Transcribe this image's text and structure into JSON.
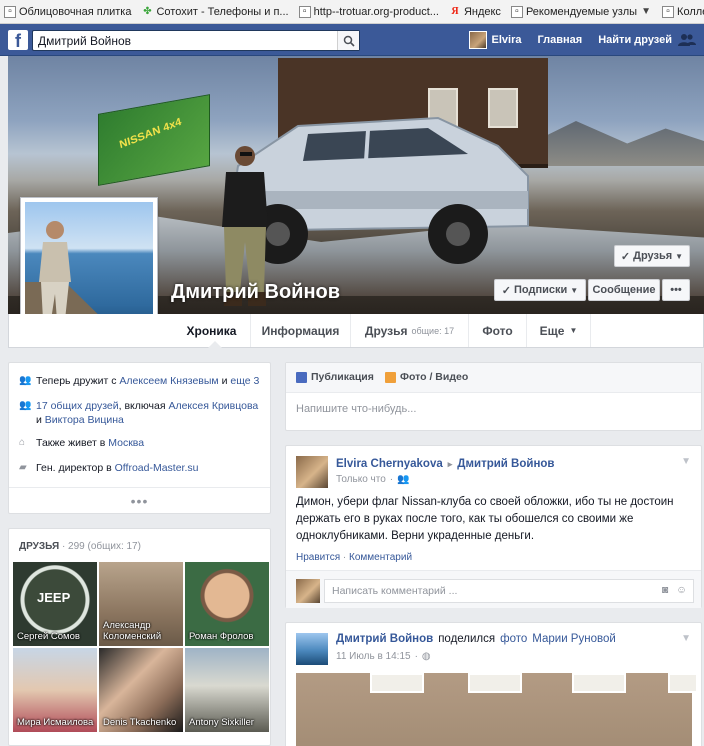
{
  "bookmarks": [
    {
      "icon": "page-icon",
      "label": "Облицовочная плитка"
    },
    {
      "icon": "leaf-icon",
      "label": "Сотохит - Телефоны и п..."
    },
    {
      "icon": "page-icon",
      "label": "http--trotuar.org-product..."
    },
    {
      "icon": "yandex-icon",
      "label": "Яндекс"
    },
    {
      "icon": "page-icon",
      "label": "Рекомендуемые узлы"
    },
    {
      "icon": "page-icon",
      "label": "Коллекция веб-фрагм..."
    }
  ],
  "topbar": {
    "logo": "f",
    "search_value": "Дмитрий Войнов",
    "user": "Elvira",
    "home": "Главная",
    "find_friends": "Найти друзей"
  },
  "profile": {
    "name": "Дмитрий Войнов",
    "flag_text": "NISSAN 4x4",
    "friends_button": "Друзья",
    "subscriptions_button": "Подписки",
    "message_button": "Сообщение",
    "more_button": "•••"
  },
  "tabs": [
    {
      "label": "Хроника",
      "sub": ""
    },
    {
      "label": "Информация",
      "sub": ""
    },
    {
      "label": "Друзья",
      "sub": "общие: 17"
    },
    {
      "label": "Фото",
      "sub": ""
    },
    {
      "label": "Еще",
      "sub": ""
    }
  ],
  "intro": {
    "row1": {
      "text": "Теперь дружит с",
      "link1": "Алексеем Князевым",
      "and": "и",
      "link2": "еще 3"
    },
    "row2": {
      "link1": "17 общих друзей",
      "text": ", включая",
      "link2": "Алексея Кривцова",
      "and": "и",
      "link3": "Виктора Вицина"
    },
    "row3": {
      "text": "Также живет в",
      "link": "Москва"
    },
    "row4": {
      "text": "Ген. директор в",
      "link": "Offroad-Master.su"
    },
    "more": "•••"
  },
  "friends_card": {
    "title": "Друзья",
    "count": "· 299 (общих: 17)",
    "items": [
      {
        "name": "Сергей Сомов"
      },
      {
        "name": "Александр Коломенский"
      },
      {
        "name": "Роман Фролов"
      },
      {
        "name": "Мира Исмаилова"
      },
      {
        "name": "Denis Tkachenko"
      },
      {
        "name": "Antony Sixkiller"
      }
    ],
    "jeep_text": "JEEP"
  },
  "composer": {
    "tab1": "Публикация",
    "tab2": "Фото / Видео",
    "placeholder": "Напишите что-нибудь..."
  },
  "post1": {
    "author": "Elvira Chernyakova",
    "arrow": "▸",
    "target": "Дмитрий Войнов",
    "time": "Только что",
    "text": "Димон, убери флаг Nissan-клуба со своей обложки, ибо ты не достоин держать его в руках после того, как ты обошелся со своими же одноклубниками. Верни украденные деньги.",
    "like": "Нравится",
    "sep": "·",
    "comment": "Комментарий",
    "comment_placeholder": "Написать комментарий ..."
  },
  "post2": {
    "author": "Дмитрий Войнов",
    "action": "поделился",
    "photo_link": "фото",
    "owner": "Марии Руновой",
    "time": "11 Июль в 14:15",
    "time_sep": "·"
  }
}
